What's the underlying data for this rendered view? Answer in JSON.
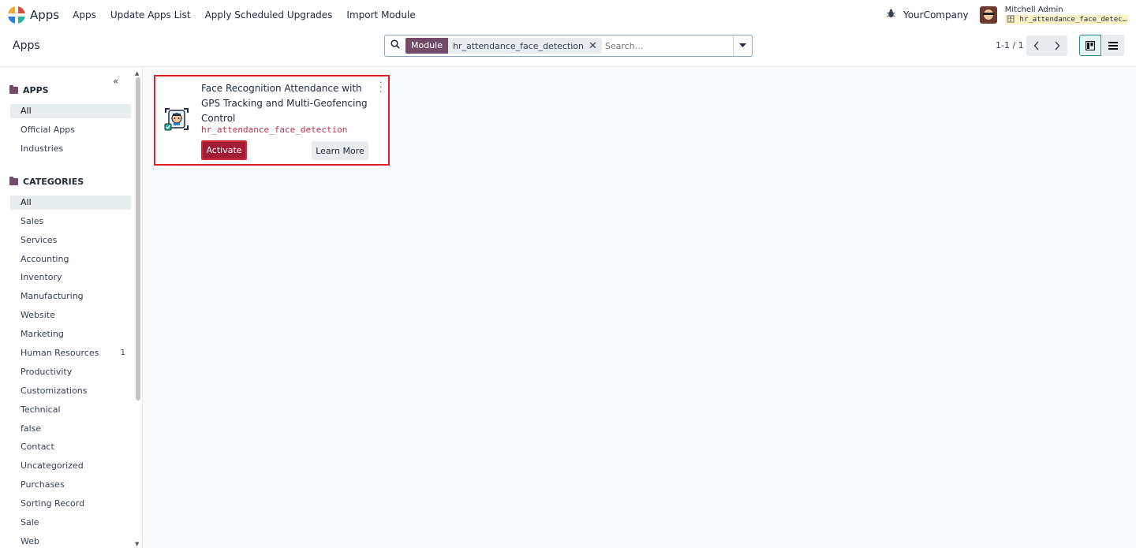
{
  "navbar": {
    "brand": "Apps",
    "menu": [
      "Apps",
      "Update Apps List",
      "Apply Scheduled Upgrades",
      "Import Module"
    ],
    "company": "YourCompany",
    "user_name": "Mitchell Admin",
    "database": "hr_attendance_face_detec…",
    "icons": {
      "logo": "odoo-apps-logo",
      "debug": "bug-icon",
      "avatar": "user-avatar"
    }
  },
  "control_panel": {
    "breadcrumb": "Apps",
    "search": {
      "facet_label": "Module",
      "facet_value": "hr_attendance_face_detection",
      "facet_close": "✕",
      "placeholder": "Search..."
    },
    "pager": "1-1 / 1",
    "views": [
      "kanban",
      "list"
    ]
  },
  "sidebar": {
    "apps_heading": "APPS",
    "apps_items": [
      {
        "label": "All",
        "active": true
      },
      {
        "label": "Official Apps"
      },
      {
        "label": "Industries"
      }
    ],
    "categories_heading": "CATEGORIES",
    "categories_items": [
      {
        "label": "All",
        "active": true
      },
      {
        "label": "Sales"
      },
      {
        "label": "Services"
      },
      {
        "label": "Accounting"
      },
      {
        "label": "Inventory"
      },
      {
        "label": "Manufacturing"
      },
      {
        "label": "Website"
      },
      {
        "label": "Marketing"
      },
      {
        "label": "Human Resources",
        "count": "1"
      },
      {
        "label": "Productivity"
      },
      {
        "label": "Customizations"
      },
      {
        "label": "Technical"
      },
      {
        "label": "false"
      },
      {
        "label": "Contact"
      },
      {
        "label": "Uncategorized"
      },
      {
        "label": "Purchases"
      },
      {
        "label": "Sorting Record"
      },
      {
        "label": "Sale"
      },
      {
        "label": "Web"
      }
    ]
  },
  "card": {
    "title": "Face Recognition Attendance with GPS Tracking and Multi-Geofencing Control",
    "technical_name": "hr_attendance_face_detection",
    "activate_label": "Activate",
    "learn_more_label": "Learn More",
    "highlight_color": "#e01e24"
  },
  "colors": {
    "primary": "#714b67",
    "activate": "#a11c34",
    "technical_name": "#b5384f"
  }
}
